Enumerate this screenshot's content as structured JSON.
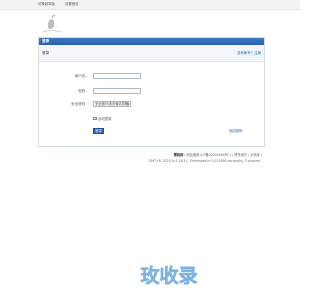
{
  "topbar": {
    "link1": "切换到窄版",
    "link2": "设置首页"
  },
  "panel": {
    "header": "登录",
    "subtitle": "登录",
    "register_link": "没有帐号？注册"
  },
  "form": {
    "username_label": "用户名：",
    "password_label": "密码：",
    "question_label": "安全提问：",
    "question_value": "安全提问(未设置请忽略)",
    "remember_label": "自动登录",
    "submit_label": "登录",
    "forgot_link": "找回密码"
  },
  "footer": {
    "line1_brand": "樱桃网",
    "line1_text": "( 网站备案 ICP备00000000号-1 | 联系我们 | 手机版 )",
    "line2_text": "GMT+8, 2023-9-4 13:31 , Processed in 0.031856 second(s), 3 queries ."
  },
  "watermark": {
    "text": "玫收录"
  },
  "colors": {
    "accent": "#2a5fa8",
    "link": "#2a63b4",
    "watermark": "#9ec6ea"
  }
}
